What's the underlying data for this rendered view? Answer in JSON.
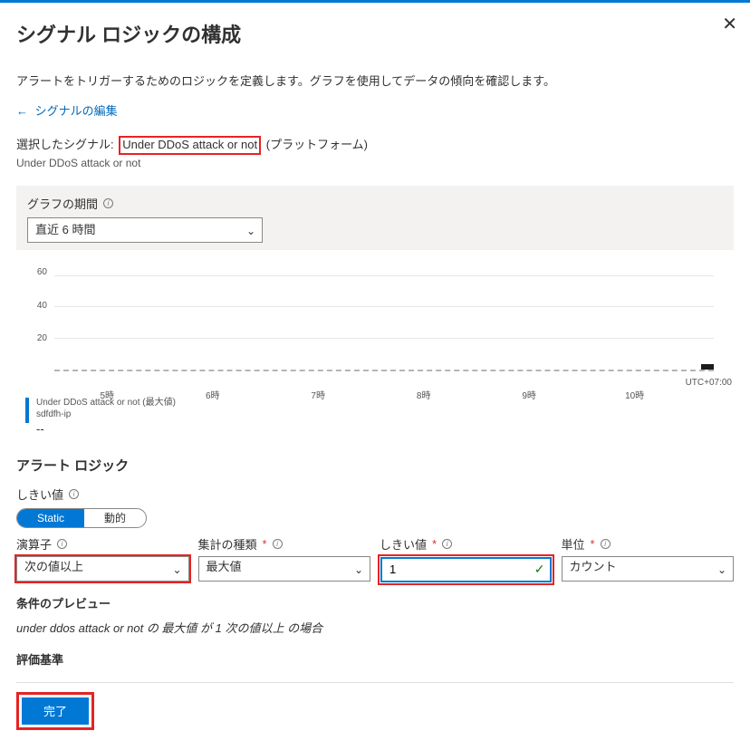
{
  "header": {
    "title": "シグナル ロジックの構成",
    "description": "アラートをトリガーするためのロジックを定義します。グラフを使用してデータの傾向を確認します。",
    "back_link": "シグナルの編集"
  },
  "signal": {
    "prefix": "選択したシグナル:",
    "name": "Under DDoS attack or not",
    "suffix": "(プラットフォーム)",
    "sub": "Under DDoS attack or not"
  },
  "graph_period": {
    "label": "グラフの期間",
    "value": "直近 6 時間"
  },
  "chart_data": {
    "type": "bar",
    "title": "",
    "xlabel": "",
    "ylabel": "",
    "ylim": [
      0,
      70
    ],
    "y_ticks": [
      20,
      40,
      60
    ],
    "x_ticks": [
      "5時",
      "6時",
      "7時",
      "8時",
      "9時",
      "10時"
    ],
    "timezone": "UTC+07:00",
    "categories": [
      "5時",
      "6時",
      "7時",
      "8時",
      "9時",
      "10時"
    ],
    "values": [
      null,
      null,
      null,
      null,
      null,
      null
    ],
    "legend": {
      "title": "Under DDoS attack or not (最大値)",
      "resource": "sdfdfh-ip",
      "value": "--"
    }
  },
  "logic": {
    "heading": "アラート ロジック",
    "threshold_label": "しきい値",
    "mode_static": "Static",
    "mode_dynamic": "動的",
    "fields": {
      "operator": {
        "label": "演算子",
        "value": "次の値以上"
      },
      "aggregation": {
        "label": "集計の種類",
        "value": "最大値"
      },
      "threshold": {
        "label": "しきい値",
        "value": "1"
      },
      "unit": {
        "label": "単位",
        "value": "カウント"
      }
    },
    "preview_heading": "条件のプレビュー",
    "preview_text": "under ddos attack or not の 最大値 が 1 次の値以上 の場合"
  },
  "evaluation": {
    "heading": "評価基準"
  },
  "footer": {
    "done": "完了"
  }
}
